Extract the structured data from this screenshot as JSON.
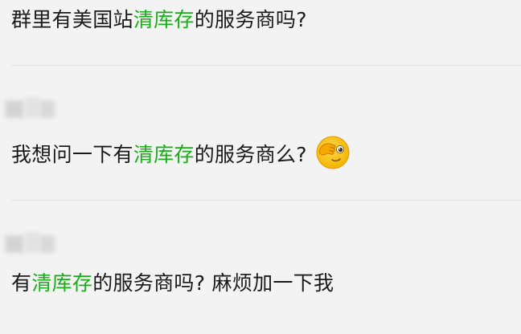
{
  "messages": [
    {
      "before": "群里有美国站",
      "keyword": "清库存",
      "after": "的服务商吗?"
    },
    {
      "before": "我想问一下有",
      "keyword": "清库存",
      "after": "的服务商么?",
      "emoji": "peeking-face-icon"
    },
    {
      "before": "有",
      "keyword": "清库存",
      "after": "的服务商吗? 麻烦加一下我"
    }
  ],
  "colors": {
    "background": "#f3f3f3",
    "text": "#1a1a1a",
    "keyword": "#1aad19",
    "divider": "#e2e2e2"
  }
}
